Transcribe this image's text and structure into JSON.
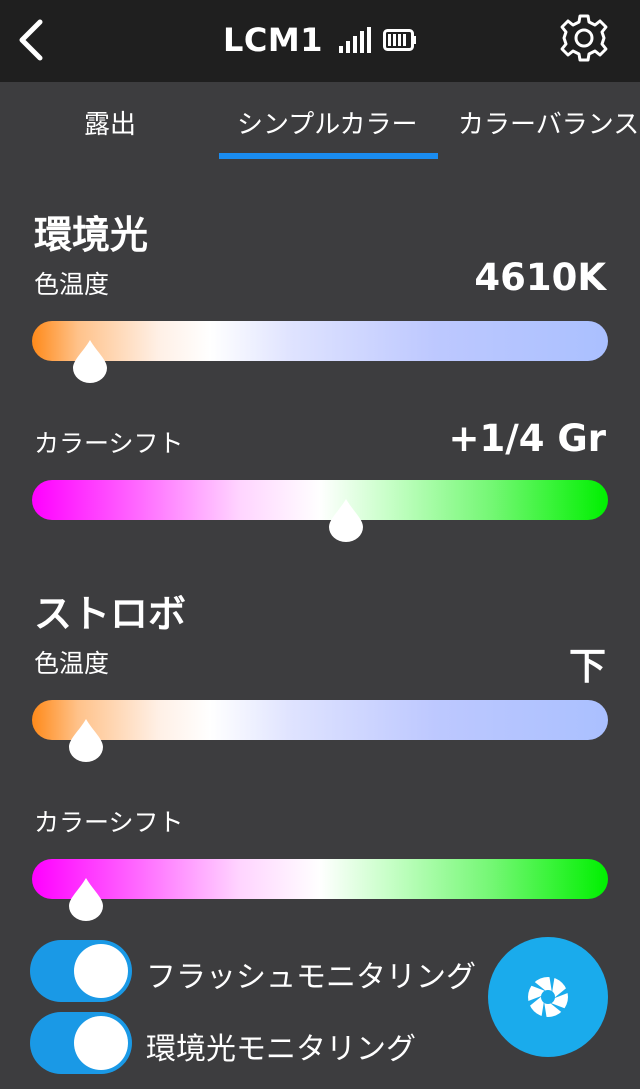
{
  "header": {
    "title": "LCM1",
    "back_icon": "chevron-left-icon",
    "signal_icon": "signal-bars-icon",
    "battery_icon": "battery-icon",
    "settings_icon": "gear-icon"
  },
  "tabs": [
    {
      "label": "露出",
      "selected": false
    },
    {
      "label": "シンプルカラー",
      "selected": true
    },
    {
      "label": "カラーバランス",
      "selected": false
    }
  ],
  "ambient": {
    "title": "環境光",
    "temp_label": "色温度",
    "temp_value": "4610K",
    "temp_position": 0.1,
    "shift_label": "カラーシフト",
    "shift_value": "+1/4 Gr",
    "shift_position": 0.546
  },
  "strobe": {
    "title": "ストロボ",
    "temp_label": "色温度",
    "temp_value": "下",
    "temp_position": 0.093,
    "shift_label": "カラーシフト",
    "shift_position": 0.093
  },
  "toggles": {
    "flash_monitoring": {
      "label": "フラッシュモニタリング",
      "on": true
    },
    "ambient_monitoring": {
      "label": "環境光モニタリング",
      "on": true
    }
  },
  "fab": {
    "icon": "aperture-icon"
  },
  "colors": {
    "accent": "#1a8cf0",
    "toggle_on": "#1a99e6",
    "fab": "#1aabec",
    "background": "#3d3d3f",
    "topbar": "#1f1f1f"
  }
}
